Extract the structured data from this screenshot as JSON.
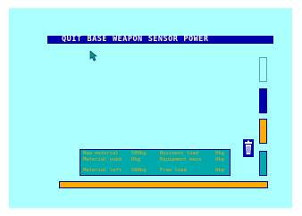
{
  "menu": {
    "items": [
      "QUIT",
      "BASE",
      "WEAPON",
      "SENSOR",
      "POWER"
    ]
  },
  "status": {
    "raw_material_label": "Raw material",
    "raw_material_value": "500kg",
    "business_load_label": "Business load",
    "business_load_value": "0kg",
    "material_used_label": "Material used",
    "material_used_value": "0kg",
    "equipment_mass_label": "Equipment mass",
    "equipment_mass_value": "0kg",
    "material_left_label": "Material left",
    "material_left_value": "500kg",
    "free_load_label": "Free load",
    "free_load_value": "0kg"
  },
  "colors": {
    "background": "#aaffff",
    "menubar": "#0000aa",
    "accent_orange": "#ffaa00",
    "panel_teal": "#00aaaa"
  },
  "icons": {
    "pointer": "arrow-cursor-icon",
    "trash": "trash-can-icon"
  }
}
